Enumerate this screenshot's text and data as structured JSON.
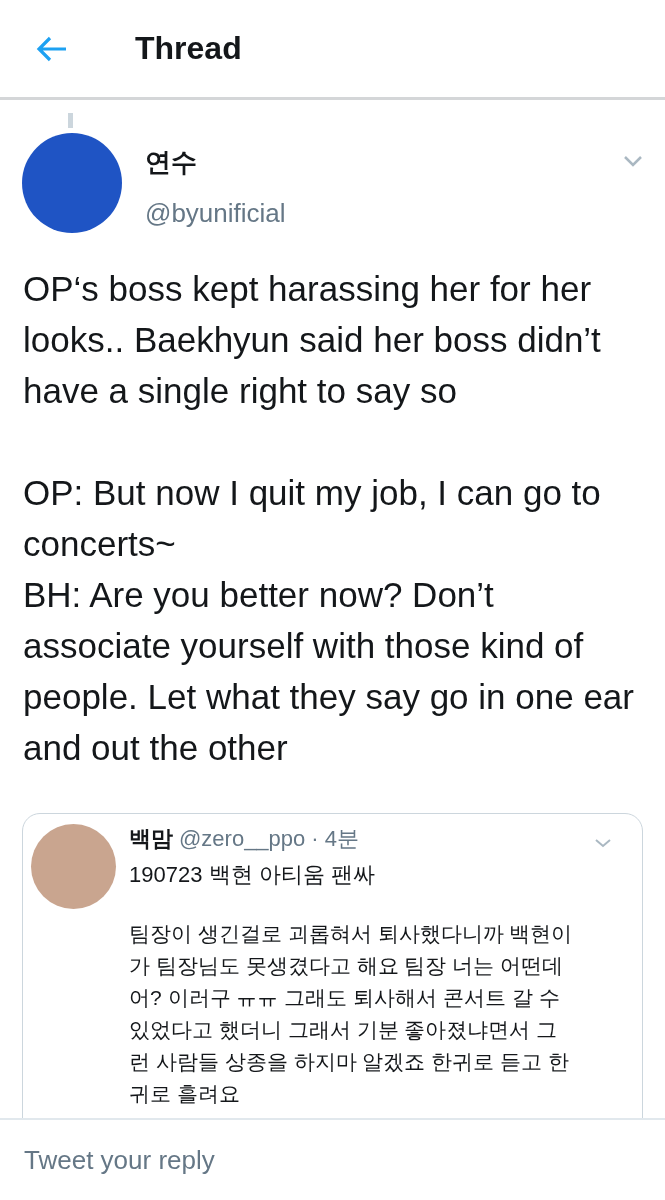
{
  "header": {
    "title": "Thread"
  },
  "tweet": {
    "name": "연수",
    "handle": "@byunificial",
    "body": [
      [
        "OP‘s boss kept harassing her for her looks.. Baekhyun said her boss didn’t have a single right to say so"
      ],
      [
        "OP: But now I quit my job, I can go to concerts~",
        "BH: Are you better now? Don’t associate yourself with those kind of people. Let what they say go in one ear and out the other"
      ]
    ]
  },
  "quoted": {
    "name": "백맘",
    "handle": "@zero__ppo",
    "time": "· 4분",
    "title": "190723 백현 아티움 팬싸",
    "body": "팀장이 생긴걸로 괴롭혀서 퇴사했다니까 백현이가 팀장님도 못생겼다고 해요 팀장 너는 어떤데 어? 이러구 ㅠㅠ 그래도 퇴사해서 콘서트 갈 수 있었다고 했더니 그래서 기분 좋아졌냐면서 그런 사람들 상종을 하지마 알겠죠 한귀로 듣고 한귀로 흘려요"
  },
  "reply": {
    "placeholder": "Tweet your reply"
  }
}
